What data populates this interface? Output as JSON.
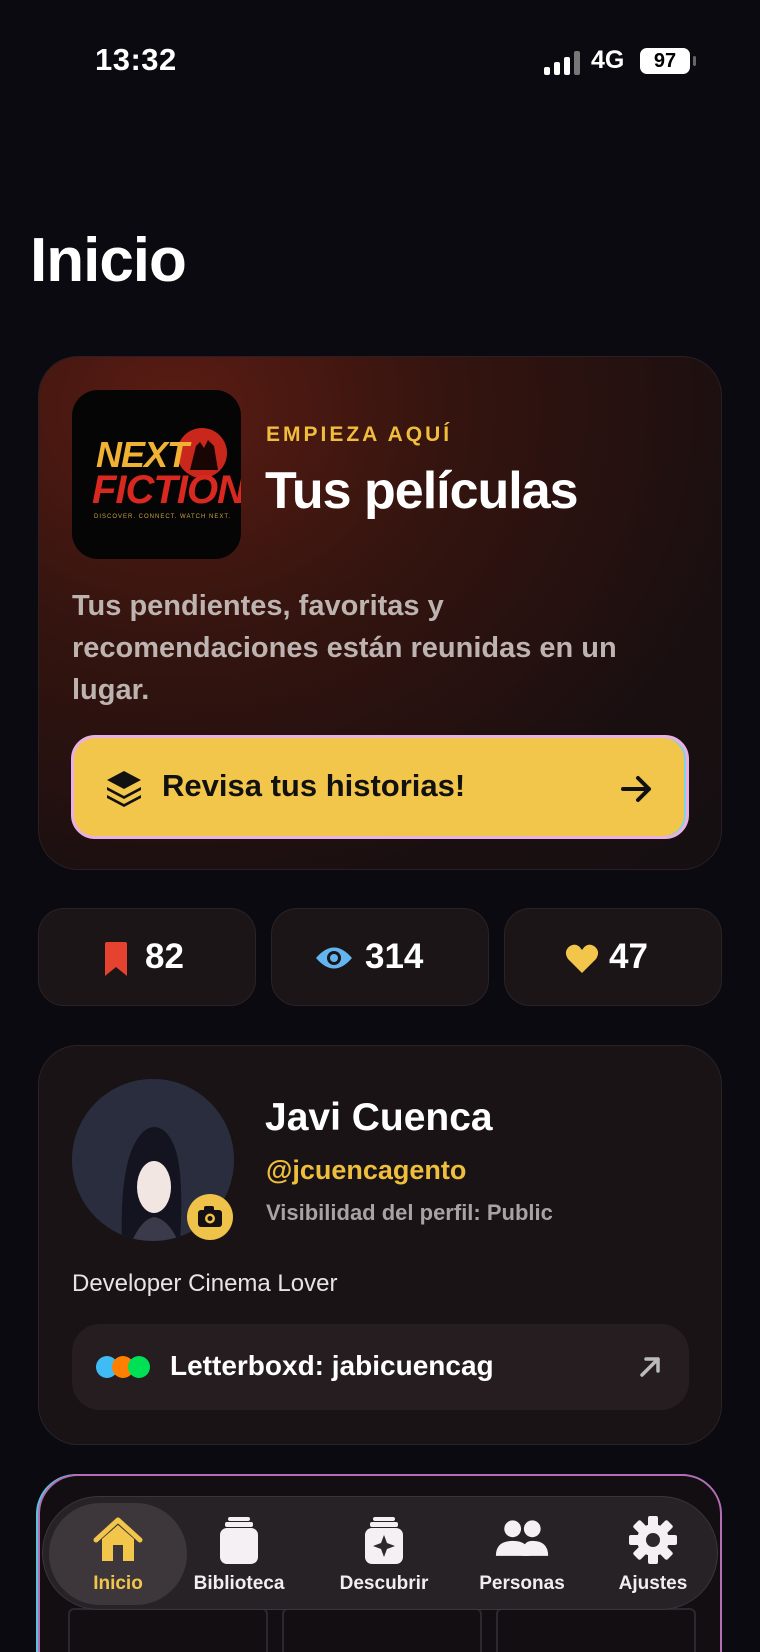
{
  "status_bar": {
    "time": "13:32",
    "network": "4G",
    "battery": "97"
  },
  "page": {
    "title": "Inicio"
  },
  "hero": {
    "logo_line1": "NEXT",
    "logo_line2": "FICTION",
    "logo_tagline": "DISCOVER. CONNECT. WATCH NEXT.",
    "eyebrow": "EMPIEZA AQUÍ",
    "title": "Tus películas",
    "description": "Tus pendientes, favoritas y recomendaciones están reunidas en un lugar.",
    "cta_label": "Revisa tus historias!",
    "cta_icon": "layers-icon",
    "cta_arrow": "arrow-right-icon"
  },
  "stats": [
    {
      "icon": "bookmark-icon",
      "value": "82",
      "color": "#e5432f"
    },
    {
      "icon": "eye-icon",
      "value": "314",
      "color": "#62b5ee"
    },
    {
      "icon": "heart-icon",
      "value": "47",
      "color": "#f2c64a"
    }
  ],
  "profile": {
    "name": "Javi Cuenca",
    "handle": "@jcuencagento",
    "visibility": "Visibilidad del perfil: Public",
    "bio": "Developer Cinema Lover",
    "letterboxd": "Letterboxd: jabicuencag"
  },
  "tabs": [
    {
      "label": "Inicio",
      "icon": "home-icon",
      "active": true
    },
    {
      "label": "Biblioteca",
      "icon": "library-icon",
      "active": false
    },
    {
      "label": "Descubrir",
      "icon": "discover-icon",
      "active": false
    },
    {
      "label": "Personas",
      "icon": "people-icon",
      "active": false
    },
    {
      "label": "Ajustes",
      "icon": "gear-icon",
      "active": false
    }
  ],
  "colors": {
    "accent": "#f2c64a",
    "background": "#0b0a10",
    "card": "#191315"
  }
}
